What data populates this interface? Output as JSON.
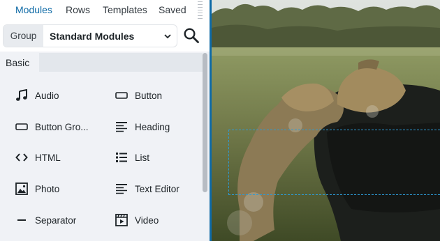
{
  "nav": {
    "tabs": [
      {
        "label": "Modules",
        "active": true
      },
      {
        "label": "Rows",
        "active": false
      },
      {
        "label": "Templates",
        "active": false
      },
      {
        "label": "Saved",
        "active": false
      }
    ]
  },
  "group": {
    "label": "Group",
    "value": "Standard Modules"
  },
  "section": {
    "active_tab": "Basic"
  },
  "modules": [
    {
      "label": "Audio",
      "icon": "music-note-icon"
    },
    {
      "label": "Button",
      "icon": "button-icon"
    },
    {
      "label": "Button Gro...",
      "icon": "button-group-icon"
    },
    {
      "label": "Heading",
      "icon": "heading-icon"
    },
    {
      "label": "HTML",
      "icon": "code-icon"
    },
    {
      "label": "List",
      "icon": "list-icon"
    },
    {
      "label": "Photo",
      "icon": "photo-icon"
    },
    {
      "label": "Text Editor",
      "icon": "text-editor-icon"
    },
    {
      "label": "Separator",
      "icon": "separator-icon"
    },
    {
      "label": "Video",
      "icon": "video-icon"
    }
  ],
  "colors": {
    "accent": "#0e6aa6",
    "panel_bg": "#f0f2f6",
    "selection": "#2c9ad6"
  }
}
